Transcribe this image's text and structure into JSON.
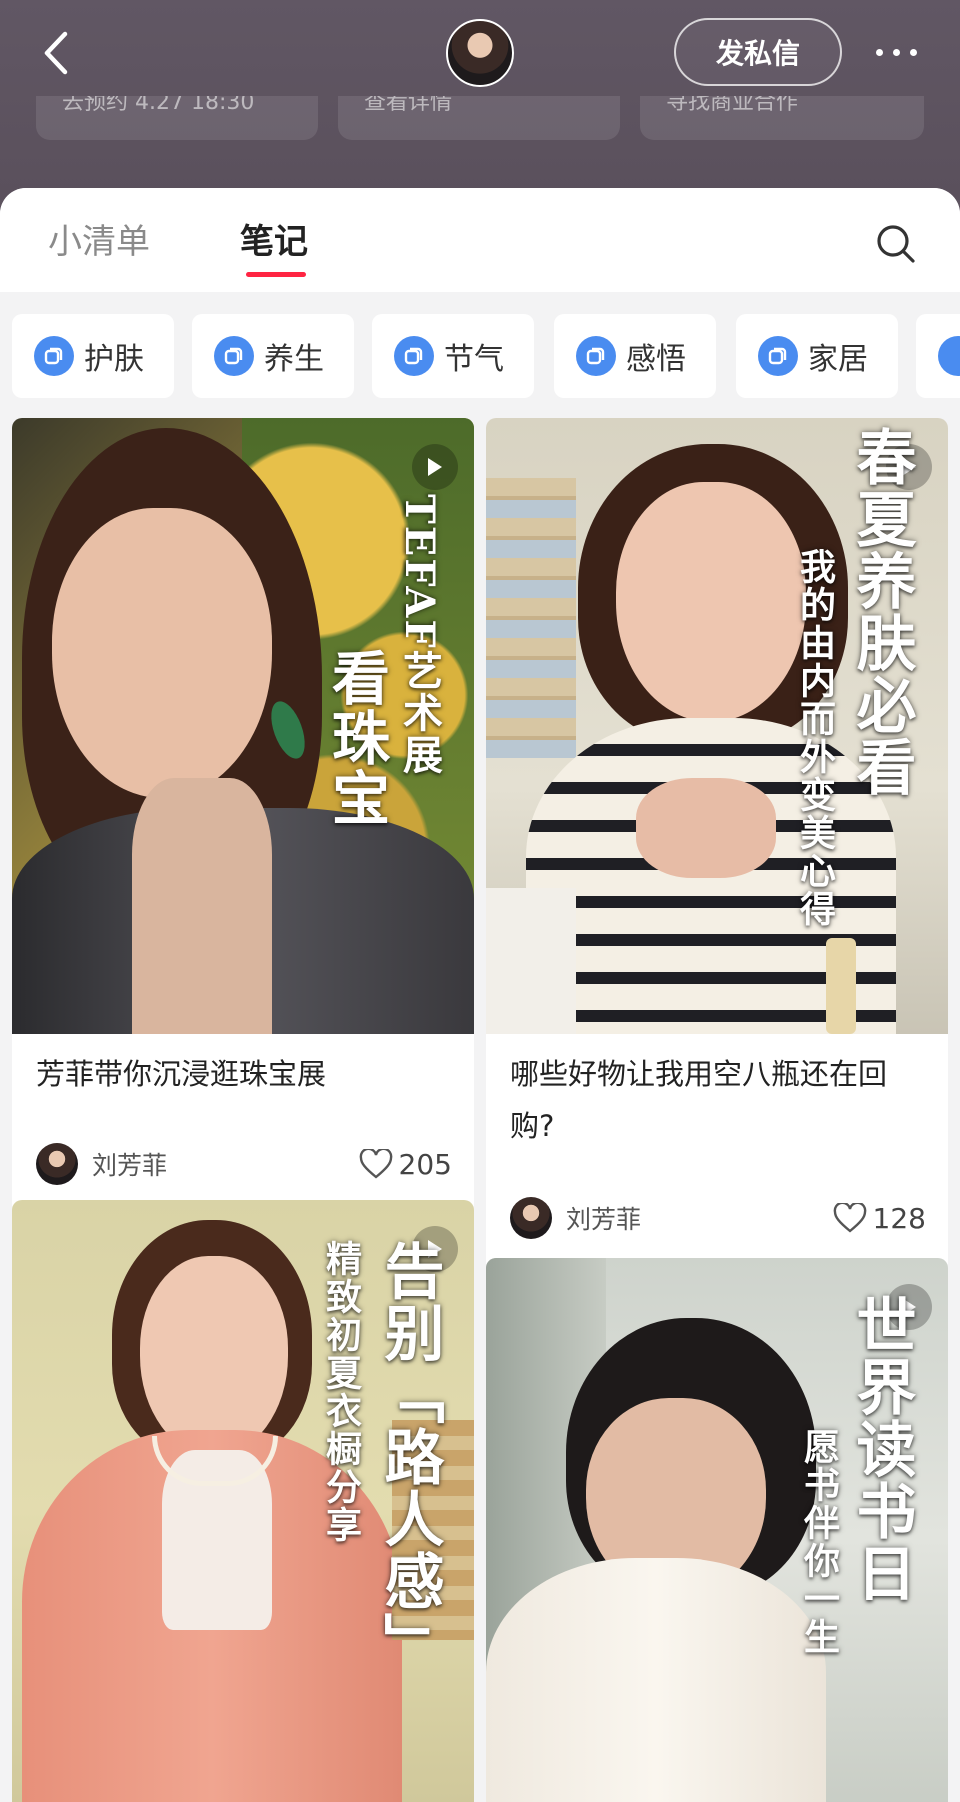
{
  "header": {
    "dm_label": "发私信",
    "quick_cards": [
      "去预约 4.27 18:30",
      "查看详情",
      "寻找商业合作"
    ]
  },
  "tabs": [
    {
      "label": "小清单",
      "active": false
    },
    {
      "label": "笔记",
      "active": true
    }
  ],
  "chips": [
    "护肤",
    "养生",
    "节气",
    "感悟",
    "家居"
  ],
  "colors": {
    "accent": "#ff2442",
    "chip_icon": "#4a8cf0"
  },
  "cards": [
    {
      "cover_text": [
        "看珠宝",
        "TEFAF艺术展"
      ],
      "title": "芳菲带你沉浸逛珠宝展",
      "author": "刘芳菲",
      "likes": "205"
    },
    {
      "cover_text": [
        "春夏养肤必看",
        "我的由内而外变美心得"
      ],
      "title": "哪些好物让我用空八瓶还在回购?",
      "author": "刘芳菲",
      "likes": "128"
    },
    {
      "cover_text": [
        "告别「路人感」",
        "精致初夏衣橱分享"
      ]
    },
    {
      "cover_text": [
        "世界读书日",
        "愿书伴你一生"
      ]
    }
  ]
}
